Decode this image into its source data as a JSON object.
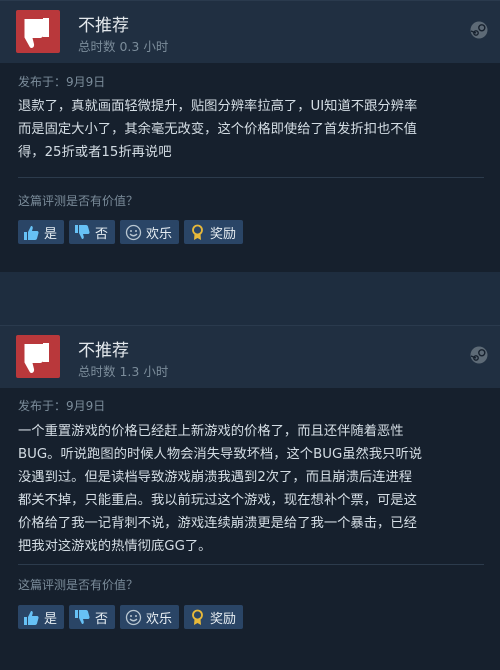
{
  "reviews": [
    {
      "verdict": "不推荐",
      "hours": "总时数 0.3 小时",
      "posted": "发布于：9月9日",
      "content": "退款了，真就画面轻微提升，贴图分辨率拉高了，UI知道不跟分辨率\n而是固定大小了，其余毫无改变，这个价格即使给了首发折扣也不值\n得，25折或者15折再说吧",
      "question": "这篇评测是否有价值？",
      "buttons": {
        "yes": "是",
        "no": "否",
        "funny": "欢乐",
        "award": "奖励"
      }
    },
    {
      "verdict": "不推荐",
      "hours": "总时数 1.3 小时",
      "posted": "发布于：9月9日",
      "content": "一个重置游戏的价格已经赶上新游戏的价格了，而且还伴随着恶性\nBUG。听说跑图的时候人物会消失导致坏档，这个BUG虽然我只听说\n没遇到过。但是读档导致游戏崩溃我遇到2次了，而且崩溃后连进程\n都关不掉，只能重启。我以前玩过这个游戏，现在想补个票，可是这\n价格给了我一记背刺不说，游戏连续崩溃更是给了我一个暴击，已经\n把我对这游戏的热情彻底GG了。",
      "question": "这篇评测是否有价值？",
      "buttons": {
        "yes": "是",
        "no": "否",
        "funny": "欢乐",
        "award": "奖励"
      }
    }
  ],
  "colors": {
    "thumb_bg": "#b9383b",
    "button_bg": "#2a4566",
    "page_bg": "#1b2838"
  },
  "icons": [
    "thumbs-down-icon",
    "steam-logo-icon",
    "thumbs-up-icon",
    "smiley-icon",
    "award-icon"
  ]
}
